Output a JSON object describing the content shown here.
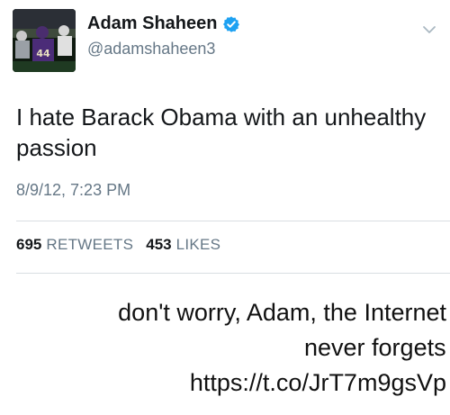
{
  "tweet": {
    "display_name": "Adam Shaheen",
    "verified": true,
    "handle": "@adamshaheen3",
    "text": "I hate Barack Obama with an unhealthy passion",
    "timestamp": "8/9/12, 7:23 PM",
    "retweets_count": "695",
    "retweets_label": "RETWEETS",
    "likes_count": "453",
    "likes_label": "LIKES",
    "avatar_jersey_number": "44"
  },
  "caption": {
    "line1": "don't worry, Adam, the Internet",
    "line2": "never forgets",
    "line3": "https://t.co/JrT7m9gsVp"
  },
  "colors": {
    "verified_blue": "#1da1f2",
    "secondary_text": "#657786",
    "divider": "#d9dee2"
  },
  "icons": {
    "verified": "verified-badge-icon",
    "menu": "chevron-down-icon"
  }
}
